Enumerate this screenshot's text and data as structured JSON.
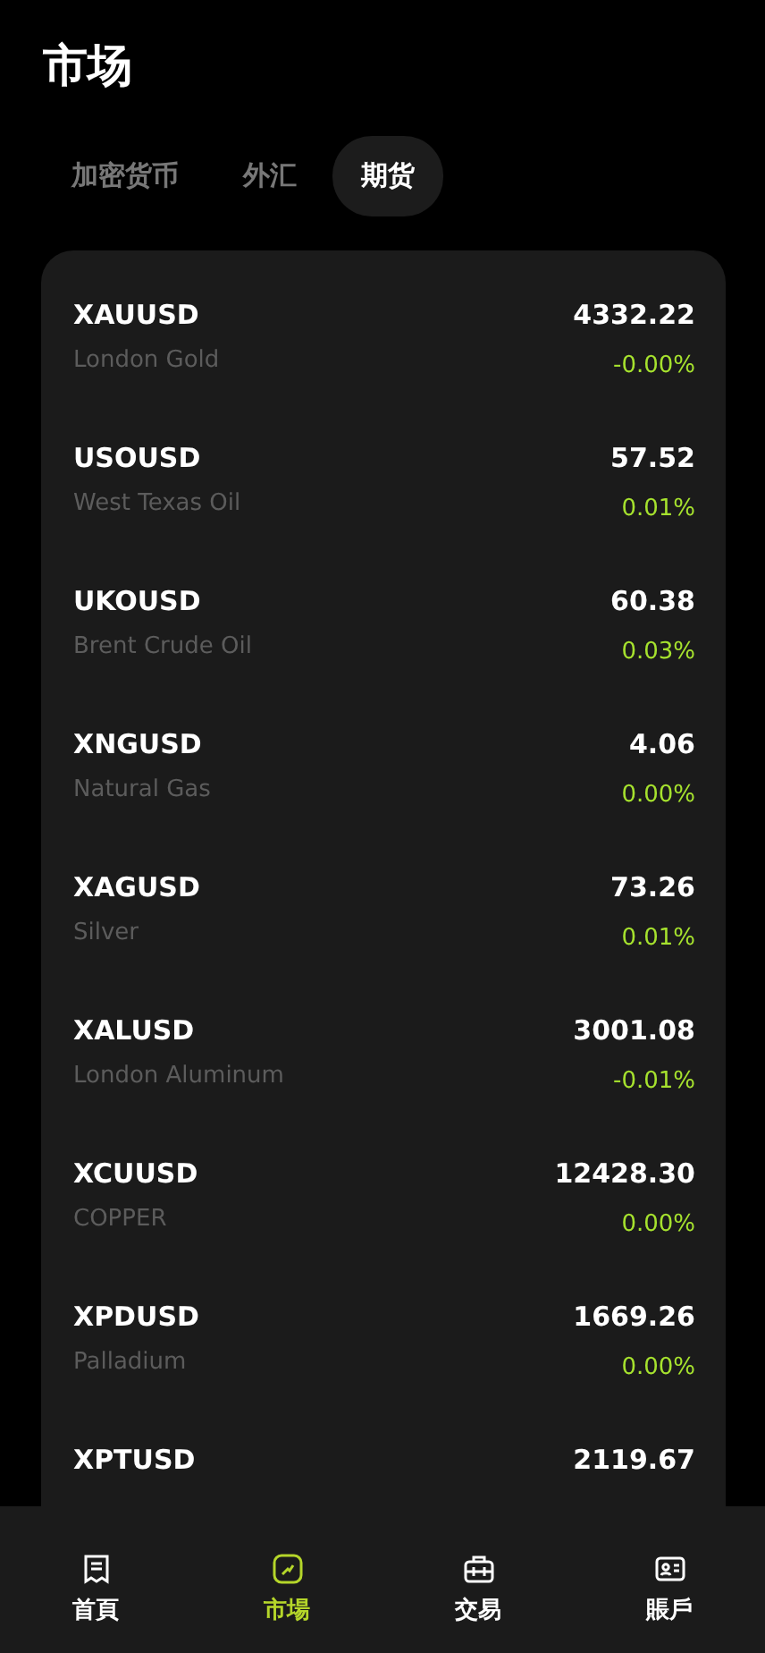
{
  "header": {
    "title": "市场"
  },
  "tabs": [
    {
      "label": "加密货币",
      "selected": false
    },
    {
      "label": "外汇",
      "selected": false
    },
    {
      "label": "期货",
      "selected": true
    }
  ],
  "quotes": [
    {
      "symbol": "XAUUSD",
      "name": "London Gold",
      "price": "4332.22",
      "change": "-0.00%"
    },
    {
      "symbol": "USOUSD",
      "name": "West Texas Oil",
      "price": "57.52",
      "change": "0.01%"
    },
    {
      "symbol": "UKOUSD",
      "name": "Brent Crude Oil",
      "price": "60.38",
      "change": "0.03%"
    },
    {
      "symbol": "XNGUSD",
      "name": "Natural Gas",
      "price": "4.06",
      "change": "0.00%"
    },
    {
      "symbol": "XAGUSD",
      "name": "Silver",
      "price": "73.26",
      "change": "0.01%"
    },
    {
      "symbol": "XALUSD",
      "name": "London Aluminum",
      "price": "3001.08",
      "change": "-0.01%"
    },
    {
      "symbol": "XCUUSD",
      "name": "COPPER",
      "price": "12428.30",
      "change": "0.00%"
    },
    {
      "symbol": "XPDUSD",
      "name": "Palladium",
      "price": "1669.26",
      "change": "0.00%"
    },
    {
      "symbol": "XPTUSD",
      "price": "2119.67"
    }
  ],
  "nav": [
    {
      "label": "首頁",
      "kind": "home",
      "selected": false
    },
    {
      "label": "市場",
      "kind": "market",
      "selected": true
    },
    {
      "label": "交易",
      "kind": "trade",
      "selected": false
    },
    {
      "label": "賬戶",
      "kind": "account",
      "selected": false
    }
  ]
}
